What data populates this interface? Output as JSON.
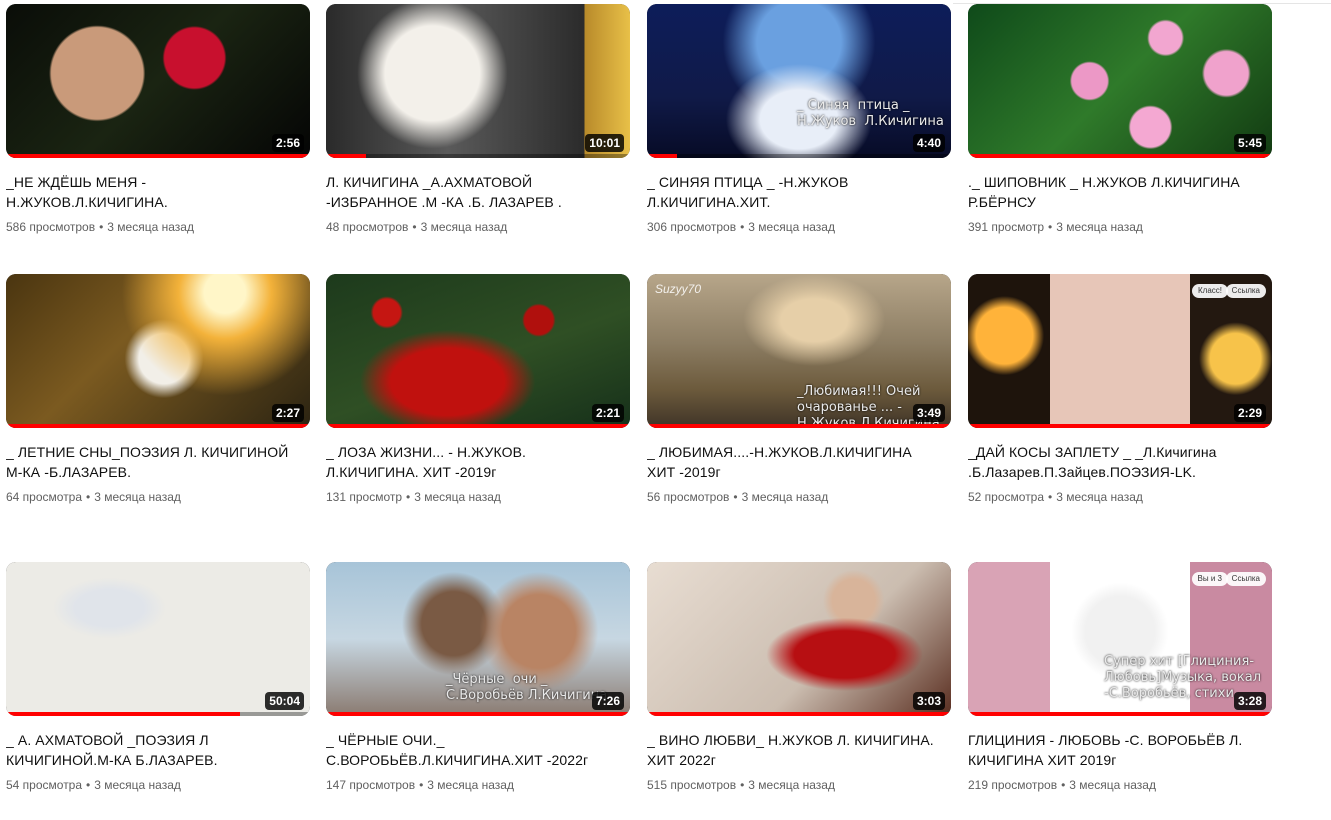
{
  "videos": [
    {
      "title": "_НЕ ЖДЁШЬ МЕНЯ -\nН.ЖУКОВ.Л.КИЧИГИНА.",
      "views": "586 просмотров",
      "age": "3 месяца назад",
      "duration": "2:56",
      "progress": 1.0,
      "overlay": ""
    },
    {
      "title": "Л. КИЧИГИНА _А.АХМАТОВОЙ\n-ИЗБРАННОЕ .М -КА .Б. ЛАЗАРЕВ .",
      "views": "48 просмотров",
      "age": "3 месяца назад",
      "duration": "10:01",
      "progress": 0.13,
      "overlay": ""
    },
    {
      "title": "_ СИНЯЯ ПТИЦА _ -Н.ЖУКОВ\nЛ.КИЧИГИНА.ХИТ.",
      "views": "306 просмотров",
      "age": "3 месяца назад",
      "duration": "4:40",
      "progress": 0.1,
      "overlay": "_ Синяя  птица _\nН.Жуков  Л.Кичигина"
    },
    {
      "title": "._ ШИПОВНИК _ Н.ЖУКОВ Л.КИЧИГИНА\nР.БЁРНСУ",
      "views": "391 просмотр",
      "age": "3 месяца назад",
      "duration": "5:45",
      "progress": 1.0,
      "overlay": ""
    },
    {
      "title": "_ ЛЕТНИЕ СНЫ_ПОЭЗИЯ Л. КИЧИГИНОЙ\nМ-КА -Б.ЛАЗАРЕВ.",
      "views": "64 просмотра",
      "age": "3 месяца назад",
      "duration": "2:27",
      "progress": 1.0,
      "overlay": ""
    },
    {
      "title": "_ ЛОЗА ЖИЗНИ... - Н.ЖУКОВ.\nЛ.КИЧИГИНА. ХИТ -2019г",
      "views": "131 просмотр",
      "age": "3 месяца назад",
      "duration": "2:21",
      "progress": 1.0,
      "overlay": ""
    },
    {
      "title": "_ ЛЮБИМАЯ....-Н.ЖУКОВ.Л.КИЧИГИНА\nХИТ -2019г",
      "views": "56 просмотров",
      "age": "3 месяца назад",
      "duration": "3:49",
      "progress": 1.0,
      "overlay": "_Любимая!!! Очей\nочарованье ... -\nН.Жуков.Л.Кичигина",
      "watermark": "Suzyy70"
    },
    {
      "title": "_ДАЙ КОСЫ ЗАПЛЕТУ _ _Л.Кичигина\n.Б.Лазарев.П.Зайцев.ПОЭЗИЯ-LK.",
      "views": "52 просмотра",
      "age": "3 месяца назад",
      "duration": "2:29",
      "progress": 1.0,
      "overlay": "",
      "chips": [
        "Класс!",
        "Ссылка"
      ]
    },
    {
      "title": "_ А. АХМАТОВОЙ _ПОЭЗИЯ Л\nКИЧИГИНОЙ.М-КА Б.ЛАЗАРЕВ.",
      "views": "54 просмотра",
      "age": "3 месяца назад",
      "duration": "50:04",
      "progress": 0.77,
      "overlay": ""
    },
    {
      "title": "_ ЧЁРНЫЕ ОЧИ._\nС.ВОРОБЬЁВ.Л.КИЧИГИНА.ХИТ -2022г",
      "views": "147 просмотров",
      "age": "3 месяца назад",
      "duration": "7:26",
      "progress": 1.0,
      "overlay": "_Чёрные  очи _\nС.Воробьёв Л.Кичигина"
    },
    {
      "title": "_ ВИНО ЛЮБВИ_ Н.ЖУКОВ Л. КИЧИГИНА.\nХИТ 2022г",
      "views": "515 просмотров",
      "age": "3 месяца назад",
      "duration": "3:03",
      "progress": 1.0,
      "overlay": ""
    },
    {
      "title": "ГЛИЦИНИЯ - ЛЮБОВЬ -С. ВОРОБЬЁВ Л.\nКИЧИГИНА ХИТ 2019г",
      "views": "219 просмотров",
      "age": "3 месяца назад",
      "duration": "3:28",
      "progress": 1.0,
      "overlay": "Супер хит [Глициния-\nЛюбовь]Музыка, вокал\n-С.Воробьёв, стихи",
      "chips": [
        "Вы и 3",
        "Ссылка"
      ]
    }
  ]
}
